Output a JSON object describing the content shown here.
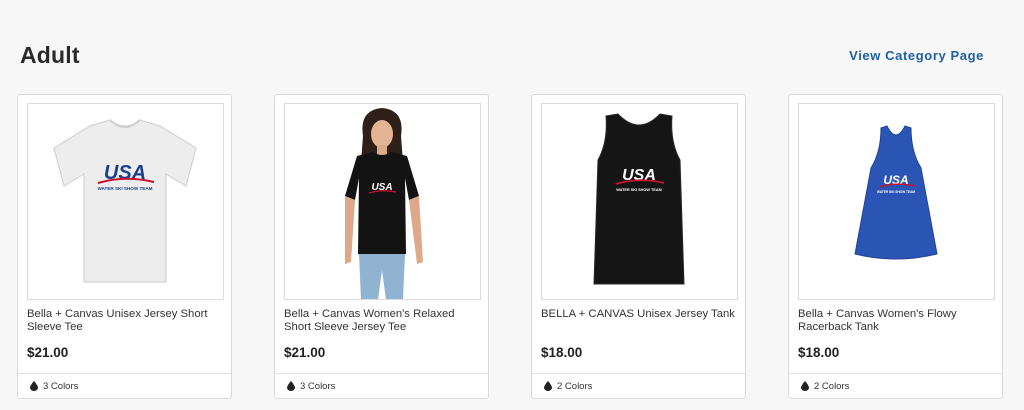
{
  "section": {
    "title": "Adult",
    "view_link": "View Category Page"
  },
  "products": [
    {
      "title": "Bella + Canvas Unisex Jersey Short Sleeve Tee",
      "price": "$21.00",
      "colors": "3 Colors",
      "garment_color": "#ececec"
    },
    {
      "title": "Bella + Canvas Women's Relaxed Short Sleeve Jersey Tee",
      "price": "$21.00",
      "colors": "3 Colors",
      "garment_color": "#111111"
    },
    {
      "title": "BELLA + CANVAS Unisex Jersey Tank",
      "price": "$18.00",
      "colors": "2 Colors",
      "garment_color": "#141414"
    },
    {
      "title": "Bella + Canvas Women's Flowy Racerback Tank",
      "price": "$18.00",
      "colors": "2 Colors",
      "garment_color": "#2a55b5"
    }
  ],
  "logo": {
    "text": "USA",
    "subtext": "WATER SKI SHOW TEAM"
  },
  "colors": {
    "link": "#1f5fa8",
    "logo_blue": "#1b3f8f",
    "logo_red": "#c8102e"
  }
}
